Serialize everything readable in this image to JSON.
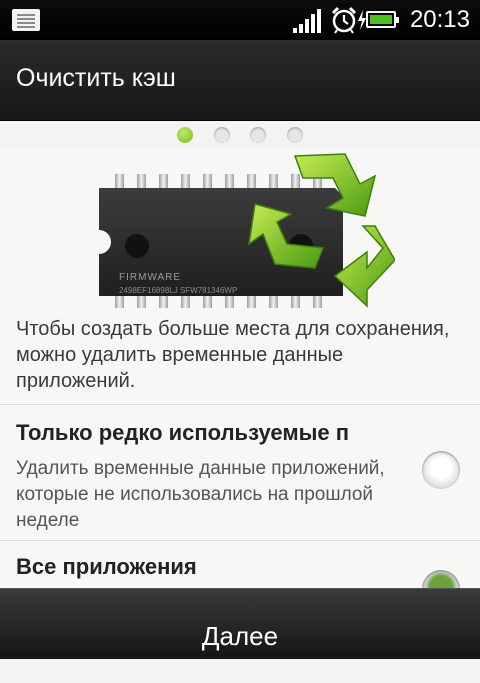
{
  "status_bar": {
    "time": "20:13",
    "icons": [
      "notification-icon",
      "signal-icon",
      "alarm-icon",
      "battery-charging-icon"
    ],
    "battery_color": "#4dbf1f"
  },
  "header": {
    "title": "Очистить кэш"
  },
  "pager": {
    "total_pages": 4,
    "current_page": 1,
    "active_color": "#8cc63f"
  },
  "hero": {
    "image_icon": "firmware-chip-recycle-icon",
    "chip_label": "FIRMWARE",
    "chip_code": "2498EF16898LJ SFW781346WP"
  },
  "intro_text": "Чтобы создать больше места для сохранения, можно удалить временные данные приложений.",
  "options": [
    {
      "title": "Только редко используемые п",
      "description": "Удалить временные данные приложений, которые не использовались на прошлой неделе",
      "selected": false
    },
    {
      "title": "Все приложения",
      "selected": true
    }
  ],
  "footer": {
    "next_label": "Далее"
  }
}
